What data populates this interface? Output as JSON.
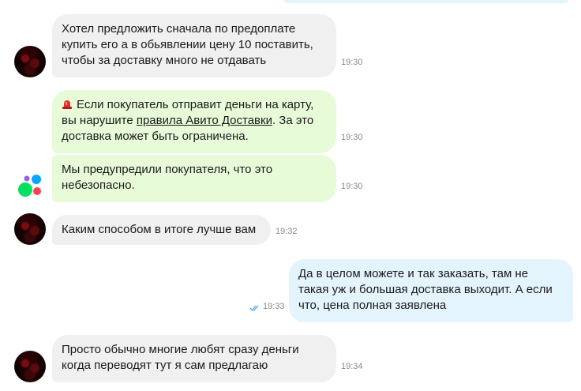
{
  "messages": [
    {
      "from": "contact",
      "lines": [
        "Хотел предложить сначала по предоплате",
        "купить его а в обьявлении цену 10 поставить,",
        "чтобы за доставку много не отдавать"
      ],
      "time": "19:30"
    },
    {
      "from": "system",
      "icon": "alarm-light-icon",
      "text_before_link": "Если покупатель отправит деньги на карту,",
      "text_line2_before": "вы нарушите ",
      "link_text": "правила Авито Доставки",
      "text_line2_after": ". За это",
      "text_line3": "доставка может быть ограничена.",
      "time": "19:30"
    },
    {
      "from": "system",
      "lines": [
        "Мы предупредили покупателя, что это",
        "небезопасно."
      ],
      "time": "19:30"
    },
    {
      "from": "contact",
      "lines": [
        "Каким способом в итоге лучше вам"
      ],
      "time": "19:32"
    },
    {
      "from": "me",
      "lines": [
        "Да в целом можете и так заказать, там не",
        "такая уж и большая доставка выходит. А если",
        "что, цена полная заявлена"
      ],
      "time": "19:33",
      "read_status": "double-check-icon"
    },
    {
      "from": "contact",
      "lines": [
        "Просто обычно многие любят сразу деньги",
        "когда переводят тут я сам предлагаю"
      ],
      "time": "19:34"
    }
  ],
  "colors": {
    "incoming_bubble": "#f1f0f0",
    "system_bubble": "#e8fbd9",
    "outgoing_bubble": "#e4f4fd",
    "time_text": "#8a8a8a",
    "read_check": "#5aa8e8",
    "avito_dots": [
      "#965eeb",
      "#0aa5ff",
      "#04e061",
      "#ff4053"
    ]
  }
}
